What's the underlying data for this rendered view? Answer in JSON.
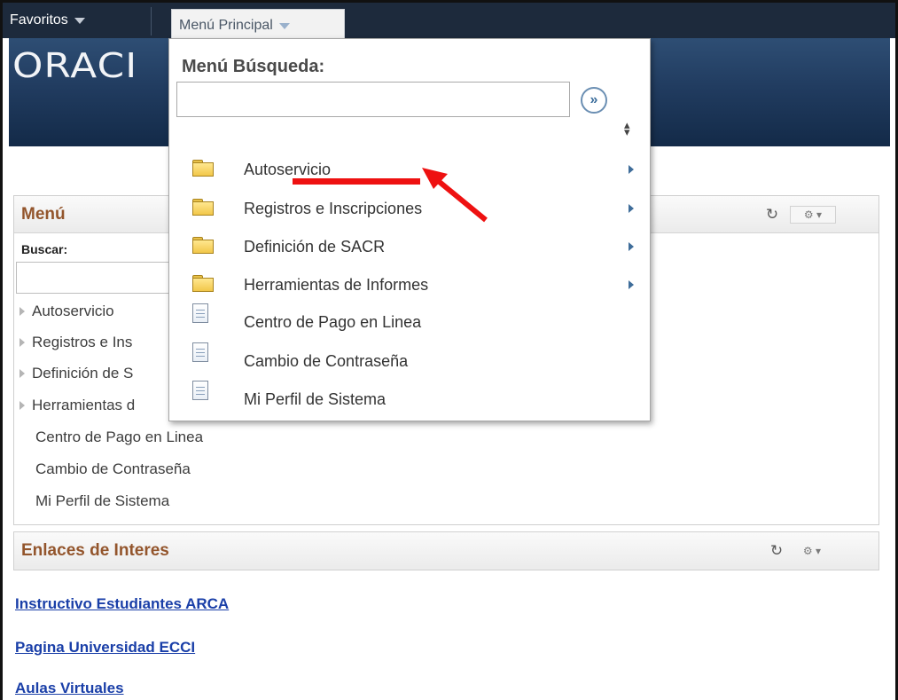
{
  "topnav": {
    "favoritos": "Favoritos",
    "menu_principal": "Menú Principal"
  },
  "header": {
    "logo_text": "ORACI"
  },
  "menu_pagelet": {
    "title": "Menú",
    "search_label": "Buscar:",
    "items": [
      {
        "label": "Autoservicio",
        "type": "folder"
      },
      {
        "label": "Registros e Ins",
        "type": "folder"
      },
      {
        "label": "Definición de S",
        "type": "folder"
      },
      {
        "label": "Herramientas d",
        "type": "folder"
      },
      {
        "label": "Centro de Pago en Linea",
        "type": "page"
      },
      {
        "label": "Cambio de Contraseña",
        "type": "page"
      },
      {
        "label": "Mi Perfil de Sistema",
        "type": "page"
      }
    ]
  },
  "enlaces_pagelet": {
    "title": "Enlaces de Interes"
  },
  "links": [
    "Instructivo Estudiantes ARCA",
    "Pagina Universidad ECCI",
    "Aulas Virtuales"
  ],
  "dropdown": {
    "search_title": "Menú Búsqueda:",
    "go_glyph": "»",
    "items": [
      {
        "label": "Autoservicio",
        "icon": "folder-icon",
        "submenu": true
      },
      {
        "label": "Registros e Inscripciones",
        "icon": "folder-icon",
        "submenu": true
      },
      {
        "label": "Definición de SACR",
        "icon": "folder-icon",
        "submenu": true
      },
      {
        "label": "Herramientas de Informes",
        "icon": "folder-icon",
        "submenu": true
      },
      {
        "label": "Centro de Pago en Linea",
        "icon": "page-icon",
        "submenu": false
      },
      {
        "label": "Cambio de Contraseña",
        "icon": "page-icon",
        "submenu": false
      },
      {
        "label": "Mi Perfil de Sistema",
        "icon": "page-icon",
        "submenu": false
      }
    ]
  },
  "colors": {
    "nav_bg": "#1d2a3c",
    "header_bg": "#213c60",
    "pagelet_title": "#93552c",
    "link": "#1a3fa8",
    "annotation": "#ee1111"
  }
}
